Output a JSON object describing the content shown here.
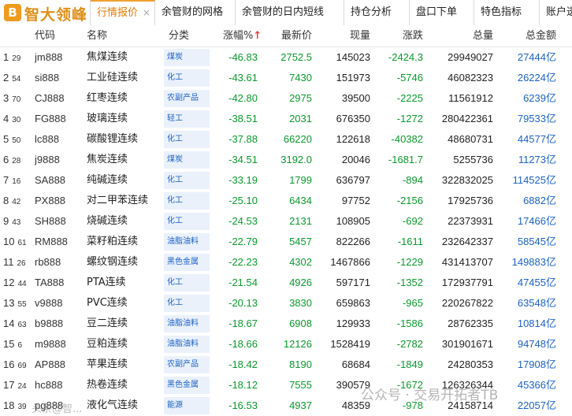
{
  "app": {
    "logo_mark": "B",
    "logo_text": "智大领峰"
  },
  "tabs": [
    {
      "label": "行情报价",
      "active": true,
      "close": "×"
    },
    {
      "label": "余管财的网格",
      "active": false
    },
    {
      "label": "余管财的日内短线",
      "active": false
    },
    {
      "label": "持仓分析",
      "active": false
    },
    {
      "label": "盘口下单",
      "active": false
    },
    {
      "label": "特色指标",
      "active": false
    },
    {
      "label": "账户透",
      "active": false
    }
  ],
  "columns": {
    "code": "代码",
    "name": "名称",
    "category": "分类",
    "change_pct": "涨幅%",
    "sort_arrow": "↑",
    "last": "最新价",
    "volume": "现量",
    "change": "涨跌",
    "total_volume": "总量",
    "total_amount": "总金额"
  },
  "rows": [
    {
      "no": "1",
      "sub": "29",
      "code": "jm888",
      "name": "焦煤连续",
      "category": "煤炭",
      "change_pct": "-46.83",
      "last": "2752.5",
      "volume": "145023",
      "change": "-2424.3",
      "total_volume": "29949027",
      "total_amount": "27444亿"
    },
    {
      "no": "2",
      "sub": "54",
      "code": "si888",
      "name": "工业硅连续",
      "category": "化工",
      "change_pct": "-43.61",
      "last": "7430",
      "volume": "151973",
      "change": "-5746",
      "total_volume": "46082323",
      "total_amount": "26224亿"
    },
    {
      "no": "3",
      "sub": "70",
      "code": "CJ888",
      "name": "红枣连续",
      "category": "农副产品",
      "change_pct": "-42.80",
      "last": "2975",
      "volume": "39500",
      "change": "-2225",
      "total_volume": "11561912",
      "total_amount": "6239亿"
    },
    {
      "no": "4",
      "sub": "30",
      "code": "FG888",
      "name": "玻璃连续",
      "category": "轻工",
      "change_pct": "-38.51",
      "last": "2031",
      "volume": "676350",
      "change": "-1272",
      "total_volume": "280422361",
      "total_amount": "79533亿"
    },
    {
      "no": "5",
      "sub": "50",
      "code": "lc888",
      "name": "碳酸锂连续",
      "category": "化工",
      "change_pct": "-37.88",
      "last": "66220",
      "volume": "122618",
      "change": "-40382",
      "total_volume": "48680731",
      "total_amount": "44577亿"
    },
    {
      "no": "6",
      "sub": "28",
      "code": "j9888",
      "name": "焦炭连续",
      "category": "煤炭",
      "change_pct": "-34.51",
      "last": "3192.0",
      "volume": "20046",
      "change": "-1681.7",
      "total_volume": "5255736",
      "total_amount": "11273亿"
    },
    {
      "no": "7",
      "sub": "16",
      "code": "SA888",
      "name": "纯碱连续",
      "category": "化工",
      "change_pct": "-33.19",
      "last": "1799",
      "volume": "636797",
      "change": "-894",
      "total_volume": "322832025",
      "total_amount": "114525亿"
    },
    {
      "no": "8",
      "sub": "42",
      "code": "PX888",
      "name": "对二甲苯连续",
      "category": "化工",
      "change_pct": "-25.10",
      "last": "6434",
      "volume": "97752",
      "change": "-2156",
      "total_volume": "17925736",
      "total_amount": "6882亿"
    },
    {
      "no": "9",
      "sub": "43",
      "code": "SH888",
      "name": "烧碱连续",
      "category": "化工",
      "change_pct": "-24.53",
      "last": "2131",
      "volume": "108905",
      "change": "-692",
      "total_volume": "22373931",
      "total_amount": "17466亿"
    },
    {
      "no": "10",
      "sub": "61",
      "code": "RM888",
      "name": "菜籽粕连续",
      "category": "油脂油料",
      "change_pct": "-22.79",
      "last": "5457",
      "volume": "822266",
      "change": "-1611",
      "total_volume": "232642337",
      "total_amount": "58545亿"
    },
    {
      "no": "11",
      "sub": "26",
      "code": "rb888",
      "name": "螺纹钢连续",
      "category": "黑色金属",
      "change_pct": "-22.23",
      "last": "4302",
      "volume": "1467866",
      "change": "-1229",
      "total_volume": "431413707",
      "total_amount": "149883亿"
    },
    {
      "no": "12",
      "sub": "44",
      "code": "TA888",
      "name": "PTA连续",
      "category": "化工",
      "change_pct": "-21.54",
      "last": "4926",
      "volume": "597171",
      "change": "-1352",
      "total_volume": "172937791",
      "total_amount": "47455亿"
    },
    {
      "no": "13",
      "sub": "55",
      "code": "v9888",
      "name": "PVC连续",
      "category": "化工",
      "change_pct": "-20.13",
      "last": "3830",
      "volume": "659863",
      "change": "-965",
      "total_volume": "220267822",
      "total_amount": "63548亿"
    },
    {
      "no": "14",
      "sub": "63",
      "code": "b9888",
      "name": "豆二连续",
      "category": "油脂油料",
      "change_pct": "-18.67",
      "last": "6908",
      "volume": "129933",
      "change": "-1586",
      "total_volume": "28762335",
      "total_amount": "10814亿"
    },
    {
      "no": "15",
      "sub": "6",
      "code": "m9888",
      "name": "豆粕连续",
      "category": "油脂油料",
      "change_pct": "-18.66",
      "last": "12126",
      "volume": "1528419",
      "change": "-2782",
      "total_volume": "301901671",
      "total_amount": "94748亿"
    },
    {
      "no": "16",
      "sub": "69",
      "code": "AP888",
      "name": "苹果连续",
      "category": "农副产品",
      "change_pct": "-18.42",
      "last": "8190",
      "volume": "68684",
      "change": "-1849",
      "total_volume": "24280353",
      "total_amount": "17908亿"
    },
    {
      "no": "17",
      "sub": "24",
      "code": "hc888",
      "name": "热卷连续",
      "category": "黑色金属",
      "change_pct": "-18.12",
      "last": "7555",
      "volume": "390579",
      "change": "-1672",
      "total_volume": "126326344",
      "total_amount": "45366亿"
    },
    {
      "no": "18",
      "sub": "39",
      "code": "pg888",
      "name": "液化气连续",
      "category": "能源",
      "change_pct": "-16.53",
      "last": "4937",
      "volume": "48359",
      "change": "-978",
      "total_volume": "24158714",
      "total_amount": "22057亿"
    }
  ],
  "watermark": {
    "text": "公众号 · 交易开拓者TB",
    "text2": "头条@智..."
  }
}
